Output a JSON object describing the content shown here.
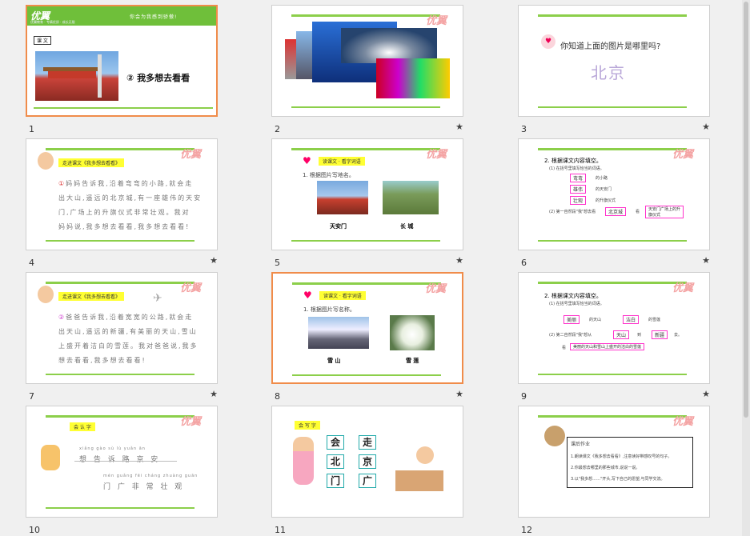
{
  "slides": [
    {
      "num": "1",
      "tag": "课 文",
      "banner": "你会为我感到骄傲!",
      "title": "② 我多想去看看",
      "logo": "优翼",
      "sub": "优翼教育 · 专精优质 · 成长无限"
    },
    {
      "num": "2",
      "logo": "优翼"
    },
    {
      "num": "3",
      "question": "你知道上面的图片是哪里吗?",
      "answer": "北京"
    },
    {
      "num": "4",
      "logo": "优翼",
      "label": "走进课文《我多想去看看》",
      "circle": "①",
      "lines": [
        "妈妈告诉我,沿着弯弯的小路,就会走",
        "出大山,遥远的北京城,有一座雄伟的天安",
        "门,广场上的升旗仪式非常壮观。我对",
        "妈妈说,我多想去看看,我多想去看看!"
      ]
    },
    {
      "num": "5",
      "logo": "优翼",
      "label": "读课文 · 看字词语",
      "task": "1. 根据图片写地名。",
      "captions": [
        "天安门",
        "长 城"
      ]
    },
    {
      "num": "6",
      "logo": "优翼",
      "head": "2. 根据课文内容填空。",
      "sub": "(1) 在括号里填写恰当的词语。",
      "items": [
        "弯弯",
        "雄伟",
        "壮观"
      ],
      "tails": [
        "的小路",
        "的天安门",
        "的升旗仪式"
      ],
      "q2a": "(2) 第一自然段\"我\"想去看",
      "ans1": "北京城",
      "q2b": "看",
      "ans2": "天安门广场上的升旗仪式"
    },
    {
      "num": "7",
      "logo": "优翼",
      "label": "走进课文《我多想去看看》",
      "circle": "②",
      "lines": [
        "爸爸告诉我,沿着宽宽的公路,就会走",
        "出天山,遥远的新疆,有美丽的天山,雪山",
        "上盛开着洁白的雪莲。我对爸爸说,我多",
        "想去看看,我多想去看看!"
      ]
    },
    {
      "num": "8",
      "logo": "优翼",
      "label": "读课文 · 看字词语",
      "task": "1. 根据图片写名称。",
      "captions": [
        "雪 山",
        "雪 莲"
      ]
    },
    {
      "num": "9",
      "logo": "优翼",
      "head": "2. 根据课文内容填空。",
      "sub": "(1) 在括号里填写恰当的词语。",
      "items": [
        "美丽",
        "洁白"
      ],
      "tails": [
        "的天山",
        "的雪莲"
      ],
      "q2a": "(2) 第二自然段\"我\"想从",
      "ans1": "天山",
      "q2b": "到",
      "ans2": "新疆",
      "q2c": "去。",
      "q3a": "看",
      "ans3": "美丽的天山和雪山上盛开的洁白的雪莲"
    },
    {
      "num": "10",
      "logo": "优翼",
      "label": "会 认 字",
      "py1": "xiǎng gào sù lù yuǎn ān",
      "cn1": "想 告 诉 路 京 安",
      "py2": "mén guǎng fēi cháng zhuàng guān",
      "cn2": "门 广 非 常 壮 观"
    },
    {
      "num": "11",
      "label": "会 写 字",
      "chars": [
        "会",
        "走",
        "北",
        "京",
        "门",
        "广"
      ]
    },
    {
      "num": "12",
      "logo": "优翼",
      "hw_title": "课后作业",
      "hw": [
        "1.朗读课文《我多想去看看》,注意读好带感叹号的句子。",
        "2.你最想去哪里的那些城市,说说一说。",
        "3.以\"我多想……\"开头,写下自己的愿望,与同学交流。"
      ]
    }
  ],
  "colors": {
    "accent_green": "#8ccf4a",
    "selected_border": "#f08c4a",
    "highlight_yellow": "#ffff33",
    "answer_border": "#ff33cc",
    "logo_pink": "#f4a3a3"
  },
  "icons": {
    "star": "★"
  }
}
